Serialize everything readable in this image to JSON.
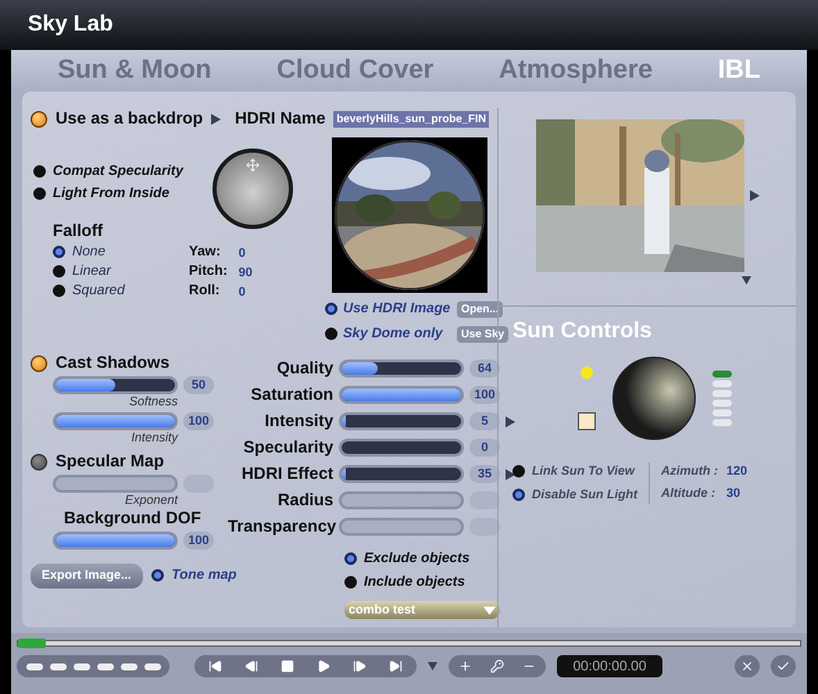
{
  "window": {
    "title": "Sky Lab"
  },
  "tabs": [
    {
      "label": "Sun & Moon",
      "selected": false
    },
    {
      "label": "Cloud Cover",
      "selected": false
    },
    {
      "label": "Atmosphere",
      "selected": false
    },
    {
      "label": "IBL",
      "selected": true
    }
  ],
  "backdrop": {
    "label": "Use as a backdrop",
    "on": true
  },
  "hdri_name": {
    "label": "HDRI Name",
    "value": "beverlyHills_sun_probe_FIN"
  },
  "options": [
    {
      "label": "Compat Specularity",
      "on": false
    },
    {
      "label": "Light From Inside",
      "on": false
    }
  ],
  "falloff": {
    "label": "Falloff",
    "options": [
      {
        "label": "None",
        "selected": true
      },
      {
        "label": "Linear",
        "selected": false
      },
      {
        "label": "Squared",
        "selected": false
      }
    ]
  },
  "rotation": [
    {
      "label": "Yaw:",
      "value": "0"
    },
    {
      "label": "Pitch:",
      "value": "90"
    },
    {
      "label": "Roll:",
      "value": "0"
    }
  ],
  "source": [
    {
      "label": "Use HDRI Image",
      "selected": true,
      "button": "Open..."
    },
    {
      "label": "Sky Dome only",
      "selected": false,
      "button": "Use Sky"
    }
  ],
  "shadows": {
    "label": "Cast Shadows",
    "on": true,
    "sliders": [
      {
        "label": "Softness",
        "level": 0.5,
        "value": "50",
        "disabled": false
      },
      {
        "label": "Intensity",
        "level": 1,
        "value": "100",
        "disabled": false
      }
    ]
  },
  "specular_map": {
    "label": "Specular Map",
    "on": false,
    "slider": {
      "label": "Exponent",
      "disabled": true
    }
  },
  "background_dof": {
    "label": "Background DOF",
    "level": 1,
    "value": "100",
    "disabled": false
  },
  "export_button": "Export Image...",
  "tone_map": {
    "label": "Tone map",
    "on": true
  },
  "sliders": [
    {
      "label": "Quality",
      "level": 0.3,
      "value": "64",
      "disabled": false,
      "arrow": false
    },
    {
      "label": "Saturation",
      "level": 1,
      "value": "100",
      "disabled": false,
      "arrow": false
    },
    {
      "label": "Intensity",
      "level": 0.03,
      "value": "5",
      "disabled": false,
      "arrow": true
    },
    {
      "label": "Specularity",
      "level": 0,
      "value": "0",
      "disabled": false,
      "arrow": false
    },
    {
      "label": "HDRI Effect",
      "level": 0.03,
      "value": "35",
      "disabled": false,
      "arrow": true
    },
    {
      "label": "Radius",
      "disabled": true,
      "arrow": false
    },
    {
      "label": "Transparency",
      "disabled": true,
      "arrow": false
    }
  ],
  "objects": [
    {
      "label": "Exclude objects",
      "selected": true
    },
    {
      "label": "Include objects",
      "selected": false
    }
  ],
  "combo": {
    "value": "combo test"
  },
  "sun_controls": {
    "title": "Sun Controls",
    "options": [
      {
        "label": "Link Sun To View",
        "on": false
      },
      {
        "label": "Disable Sun Light",
        "on": true
      }
    ],
    "readouts": [
      {
        "label": "Azimuth :",
        "value": "120"
      },
      {
        "label": "Altitude :",
        "value": "30"
      }
    ]
  },
  "time": "00:00:00.00"
}
